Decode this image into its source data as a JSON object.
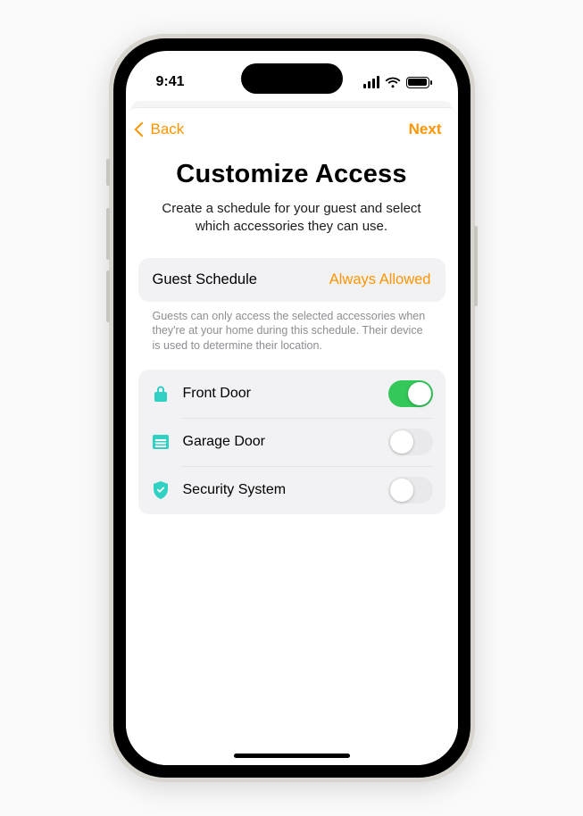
{
  "status": {
    "time": "9:41"
  },
  "nav": {
    "back": "Back",
    "next": "Next"
  },
  "page": {
    "title": "Customize Access",
    "subtitle": "Create a schedule for your guest and select which accessories they can use."
  },
  "schedule": {
    "label": "Guest Schedule",
    "value": "Always Allowed",
    "footnote": "Guests can only access the selected accessories when they're at your home during this schedule. Their device is used to determine their location."
  },
  "accessories": [
    {
      "name": "Front Door",
      "icon": "lock",
      "enabled": true
    },
    {
      "name": "Garage Door",
      "icon": "garage",
      "enabled": false
    },
    {
      "name": "Security System",
      "icon": "shield",
      "enabled": false
    }
  ],
  "colors": {
    "accent": "#ff9500",
    "teal": "#30d0c3",
    "toggle_on": "#34c759"
  }
}
